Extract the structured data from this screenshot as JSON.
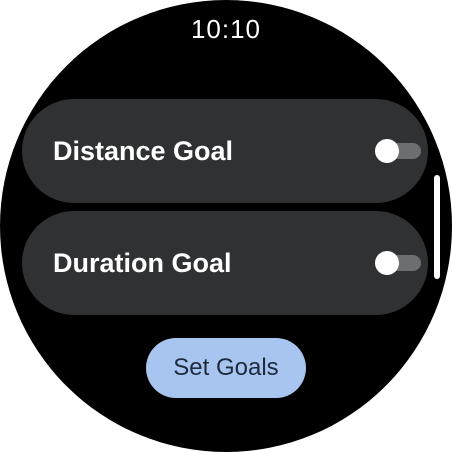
{
  "status": {
    "time": "10:10"
  },
  "goals": [
    {
      "label": "Distance Goal",
      "enabled": false
    },
    {
      "label": "Duration Goal",
      "enabled": false
    }
  ],
  "action": {
    "set_goals_label": "Set Goals"
  },
  "colors": {
    "background": "#000000",
    "chip": "#303133",
    "toggle_track_off": "#6d6e71",
    "toggle_thumb": "#ffffff",
    "button_primary": "#a8c5f0",
    "button_text": "#1f2a3d"
  }
}
